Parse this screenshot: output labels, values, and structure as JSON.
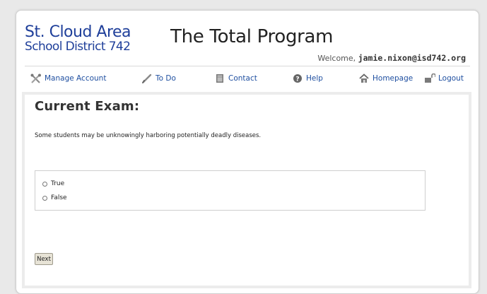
{
  "logo": {
    "line1": "St. Cloud Area",
    "line2": "School District 742"
  },
  "site_title": "The Total Program",
  "welcome": {
    "prefix": "Welcome,",
    "user": "jamie.nixon@isd742.org"
  },
  "nav": {
    "items": [
      {
        "label": "Manage Account",
        "icon": "tools-icon"
      },
      {
        "label": "To Do",
        "icon": "checkmark-icon"
      },
      {
        "label": "Contact",
        "icon": "book-icon"
      },
      {
        "label": "Help",
        "icon": "help-icon"
      },
      {
        "label": "Homepage",
        "icon": "home-icon"
      },
      {
        "label": "Logout",
        "icon": "logout-icon"
      }
    ]
  },
  "exam": {
    "title": "Current Exam:",
    "question": "Some students may be unknowingly harboring potentially deadly diseases.",
    "options": [
      "True",
      "False"
    ],
    "next_label": "Next"
  },
  "colors": {
    "logo_blue": "#1f3f9a",
    "link_blue": "#1f4fa0"
  }
}
